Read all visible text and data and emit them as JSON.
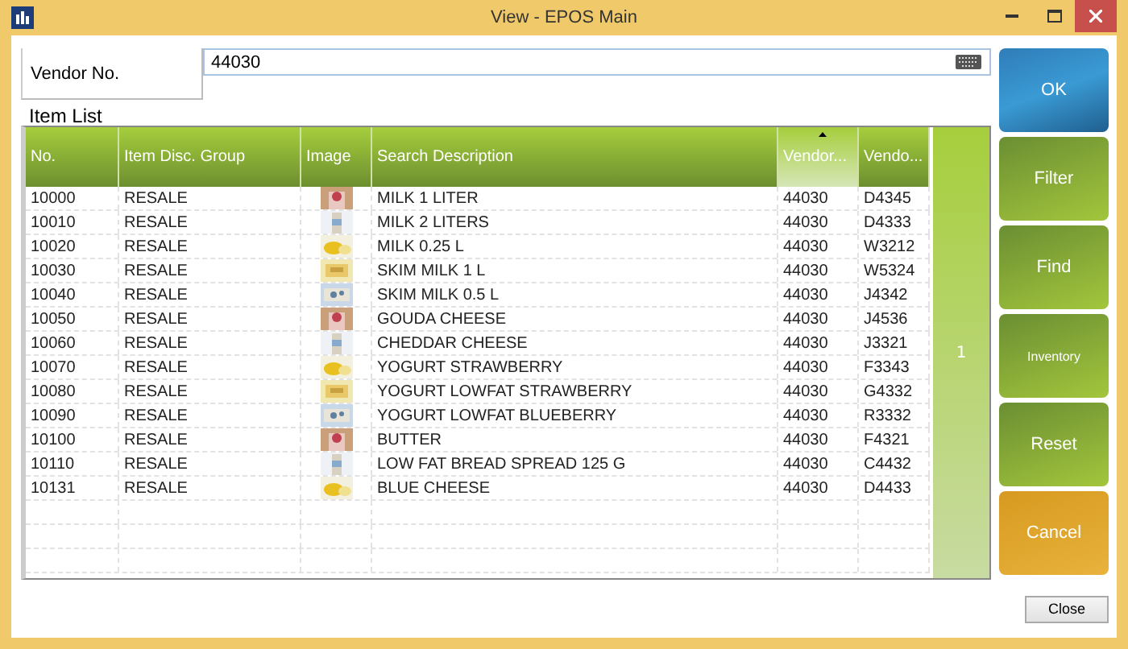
{
  "window": {
    "title": "View - EPOS Main"
  },
  "vendor": {
    "label": "Vendor No.",
    "value": "44030"
  },
  "item_list": {
    "title": "Item List"
  },
  "table": {
    "columns": [
      {
        "label": "No.",
        "sorted": false
      },
      {
        "label": "Item Disc. Group",
        "sorted": false
      },
      {
        "label": "Image",
        "sorted": false
      },
      {
        "label": "Search Description",
        "sorted": false
      },
      {
        "label": "Vendor...",
        "sorted": true
      },
      {
        "label": "Vendo...",
        "sorted": false
      }
    ],
    "rows": [
      [
        "10000",
        "RESALE",
        "",
        "MILK 1 LITER",
        "44030",
        "D4345"
      ],
      [
        "10010",
        "RESALE",
        "",
        "MILK 2 LITERS",
        "44030",
        "D4333"
      ],
      [
        "10020",
        "RESALE",
        "",
        "MILK 0.25 L",
        "44030",
        "W3212"
      ],
      [
        "10030",
        "RESALE",
        "",
        "SKIM MILK 1 L",
        "44030",
        "W5324"
      ],
      [
        "10040",
        "RESALE",
        "",
        "SKIM MILK 0.5 L",
        "44030",
        "J4342"
      ],
      [
        "10050",
        "RESALE",
        "",
        "GOUDA CHEESE",
        "44030",
        "J4536"
      ],
      [
        "10060",
        "RESALE",
        "",
        "CHEDDAR CHEESE",
        "44030",
        "J3321"
      ],
      [
        "10070",
        "RESALE",
        "",
        "YOGURT STRAWBERRY",
        "44030",
        "F3343"
      ],
      [
        "10080",
        "RESALE",
        "",
        "YOGURT LOWFAT STRAWBERRY",
        "44030",
        "G4332"
      ],
      [
        "10090",
        "RESALE",
        "",
        "YOGURT LOWFAT BLUEBERRY",
        "44030",
        "R3332"
      ],
      [
        "10100",
        "RESALE",
        "",
        "BUTTER",
        "44030",
        "F4321"
      ],
      [
        "10110",
        "RESALE",
        "",
        "LOW FAT BREAD SPREAD 125 G",
        "44030",
        "C4432"
      ],
      [
        "10131",
        "RESALE",
        "",
        "BLUE CHEESE",
        "44030",
        "D4433"
      ]
    ],
    "page": "1"
  },
  "actions": [
    {
      "label": "OK",
      "kind": "primary"
    },
    {
      "label": "Filter",
      "kind": "normal"
    },
    {
      "label": "Find",
      "kind": "normal"
    },
    {
      "label": "Inventory",
      "kind": "small"
    },
    {
      "label": "Reset",
      "kind": "normal"
    },
    {
      "label": "Cancel",
      "kind": "cancel"
    }
  ],
  "footer": {
    "close": "Close"
  }
}
